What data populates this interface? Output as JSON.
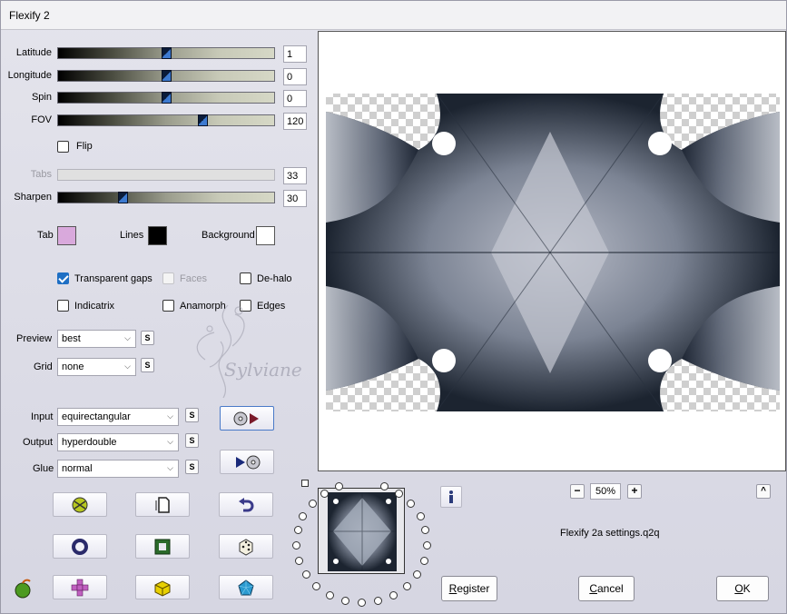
{
  "window": {
    "title": "Flexify 2"
  },
  "sliders": [
    {
      "label": "Latitude",
      "value": "1",
      "level": 0.5,
      "enabled": true
    },
    {
      "label": "Longitude",
      "value": "0",
      "level": 0.5,
      "enabled": true
    },
    {
      "label": "Spin",
      "value": "0",
      "level": 0.5,
      "enabled": true
    },
    {
      "label": "FOV",
      "value": "120",
      "level": 0.667,
      "enabled": true
    },
    {
      "label": "Tabs",
      "value": "33",
      "level": 0.33,
      "enabled": false
    },
    {
      "label": "Sharpen",
      "value": "30",
      "level": 0.3,
      "enabled": true
    }
  ],
  "flip": {
    "label": "Flip",
    "checked": false
  },
  "colors": {
    "tab": {
      "label": "Tab",
      "hex": "#d9a9dc"
    },
    "lines": {
      "label": "Lines",
      "hex": "#000000"
    },
    "background": {
      "label": "Background",
      "hex": "#ffffff"
    }
  },
  "options": {
    "transparent_gaps": {
      "label": "Transparent gaps",
      "checked": true
    },
    "faces": {
      "label": "Faces",
      "checked": false,
      "enabled": false
    },
    "dehalo": {
      "label": "De-halo",
      "checked": false
    },
    "indicatrix": {
      "label": "Indicatrix",
      "checked": false
    },
    "anamorph": {
      "label": "Anamorph",
      "checked": false
    },
    "edges": {
      "label": "Edges",
      "checked": false
    }
  },
  "selects": {
    "preview": {
      "label": "Preview",
      "value": "best"
    },
    "grid": {
      "label": "Grid",
      "value": "none"
    },
    "input": {
      "label": "Input",
      "value": "equirectangular"
    },
    "output": {
      "label": "Output",
      "value": "hyperdouble"
    },
    "glue": {
      "label": "Glue",
      "value": "normal"
    }
  },
  "s_button": "S",
  "zoom": {
    "minus": "−",
    "value": "50%",
    "plus": "+"
  },
  "collapse_button": "^",
  "settings_file": "Flexify 2a settings.q2q",
  "buttons": {
    "register": {
      "underline": "R",
      "rest": "egister"
    },
    "cancel": {
      "underline": "C",
      "rest": "ancel"
    },
    "ok": {
      "underline": "O",
      "rest": "K"
    }
  },
  "watermark": {
    "text": "Sylviane"
  },
  "icons": {
    "swap_in": "disk-to-play-icon",
    "swap_out": "play-to-disk-icon",
    "info": "info-icon"
  }
}
